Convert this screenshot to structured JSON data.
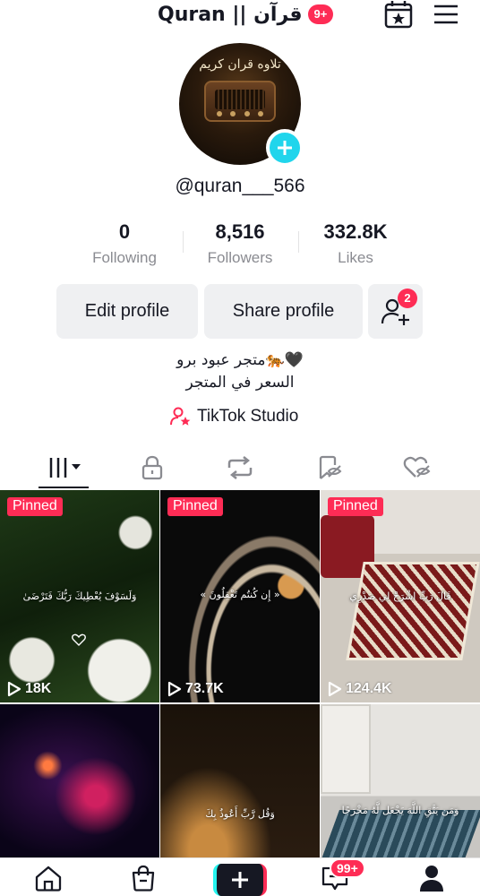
{
  "header": {
    "title": "Quran || قرآن",
    "badge": "9+",
    "calendar_icon": "calendar-star-icon",
    "menu_icon": "hamburger-menu-icon"
  },
  "profile": {
    "avatar_text": "تلاوه قران كريم",
    "username": "@quran___566"
  },
  "stats": [
    {
      "value": "0",
      "label": "Following"
    },
    {
      "value": "8,516",
      "label": "Followers"
    },
    {
      "value": "332.8K",
      "label": "Likes"
    }
  ],
  "buttons": {
    "edit": "Edit profile",
    "share": "Share profile",
    "friend_badge": "2"
  },
  "bio": {
    "line1": "متجر عبود برو🐅🖤",
    "line2": "السعر في المتجر",
    "studio": "TikTok Studio"
  },
  "tabs": [
    "videos-grid-icon",
    "lock-icon",
    "repost-icon",
    "saved-icon",
    "liked-icon"
  ],
  "videos": [
    {
      "pinned": "Pinned",
      "views": "18K",
      "caption": "وَلَسَوْفَ يُعْطِيكَ رَبُّكَ فَتَرْضَىٰ"
    },
    {
      "pinned": "Pinned",
      "views": "73.7K",
      "caption": "« إِن كُنتُم تَعْقِلُونَ »"
    },
    {
      "pinned": "Pinned",
      "views": "124.4K",
      "caption": "قَالَ رَبِّ اشْرَحْ لِي صَدْرِي"
    },
    {
      "caption": ""
    },
    {
      "caption": "وَقُل رَّبِّ أَعُوذُ بِكَ"
    },
    {
      "caption": "وَمَن يَتَّقِ اللَّهَ يَجْعَل لَّهُ مَخْرَجًا"
    }
  ],
  "nav": {
    "inbox_badge": "99+"
  },
  "colors": {
    "accent": "#fe2c55",
    "cyan": "#20d5ec",
    "text": "#161823",
    "muted": "#8a8b91",
    "button_bg": "#eff0f2"
  }
}
